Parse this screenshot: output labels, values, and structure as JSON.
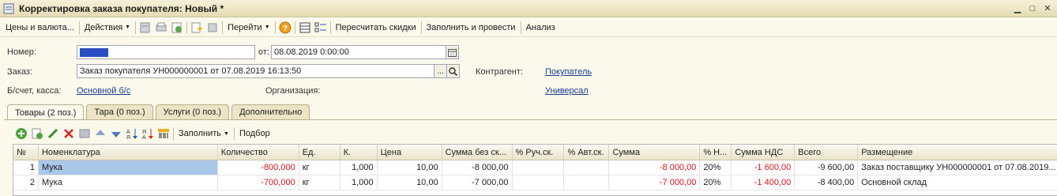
{
  "window": {
    "title": "Корректировка заказа покупателя: Новый *"
  },
  "toolbar": {
    "prices_label": "Цены и валюта...",
    "actions_label": "Действия",
    "goto_label": "Перейти",
    "recalc_label": "Пересчитать скидки",
    "fill_post_label": "Заполнить и провести",
    "analysis_label": "Анализ"
  },
  "form": {
    "number_label": "Номер:",
    "date_label": "от:",
    "date_value": "08.08.2019  0:00:00",
    "order_label": "Заказ:",
    "order_value": "Заказ покупателя УН000000001 от 07.08.2019 16:13:50",
    "order_btn": "...",
    "contractor_label": "Контрагент:",
    "contractor_value": "Покупатель",
    "account_label": "Б/счет, касса:",
    "account_value": "Основной б/с",
    "org_label": "Организация:",
    "org_value": "Универсал"
  },
  "tabs": [
    {
      "label": "Товары (2 поз.)"
    },
    {
      "label": "Тара (0 поз.)"
    },
    {
      "label": "Услуги (0 поз.)"
    },
    {
      "label": "Дополнительно"
    }
  ],
  "inner_toolbar": {
    "fill_label": "Заполнить",
    "select_label": "Подбор"
  },
  "table": {
    "headers": [
      "№",
      "Номенклатура",
      "Количество",
      "Ед.",
      "К.",
      "Цена",
      "Сумма без ск...",
      "% Руч.ск.",
      "% Авт.ск.",
      "Сумма",
      "% Н...",
      "Сумма НДС",
      "Всего",
      "Размещение"
    ],
    "rows": [
      [
        "1",
        "Мука",
        "-800,000",
        "кг",
        "1,000",
        "10,00",
        "-8 000,00",
        "",
        "",
        "-8 000,00",
        "20%",
        "-1 600,00",
        "-9 600,00",
        "Заказ поставщику УН000000001 от 07.08.2019..."
      ],
      [
        "2",
        "Мука",
        "-700,000",
        "кг",
        "1,000",
        "10,00",
        "-7 000,00",
        "",
        "",
        "-7 000,00",
        "20%",
        "-1 400,00",
        "-8 400,00",
        "Основной склад"
      ]
    ]
  },
  "colors": {
    "negative": "#e0161b",
    "link": "#1a3d8f",
    "selection": "#a9c7e8",
    "number_fill": "#2c4cc2"
  }
}
